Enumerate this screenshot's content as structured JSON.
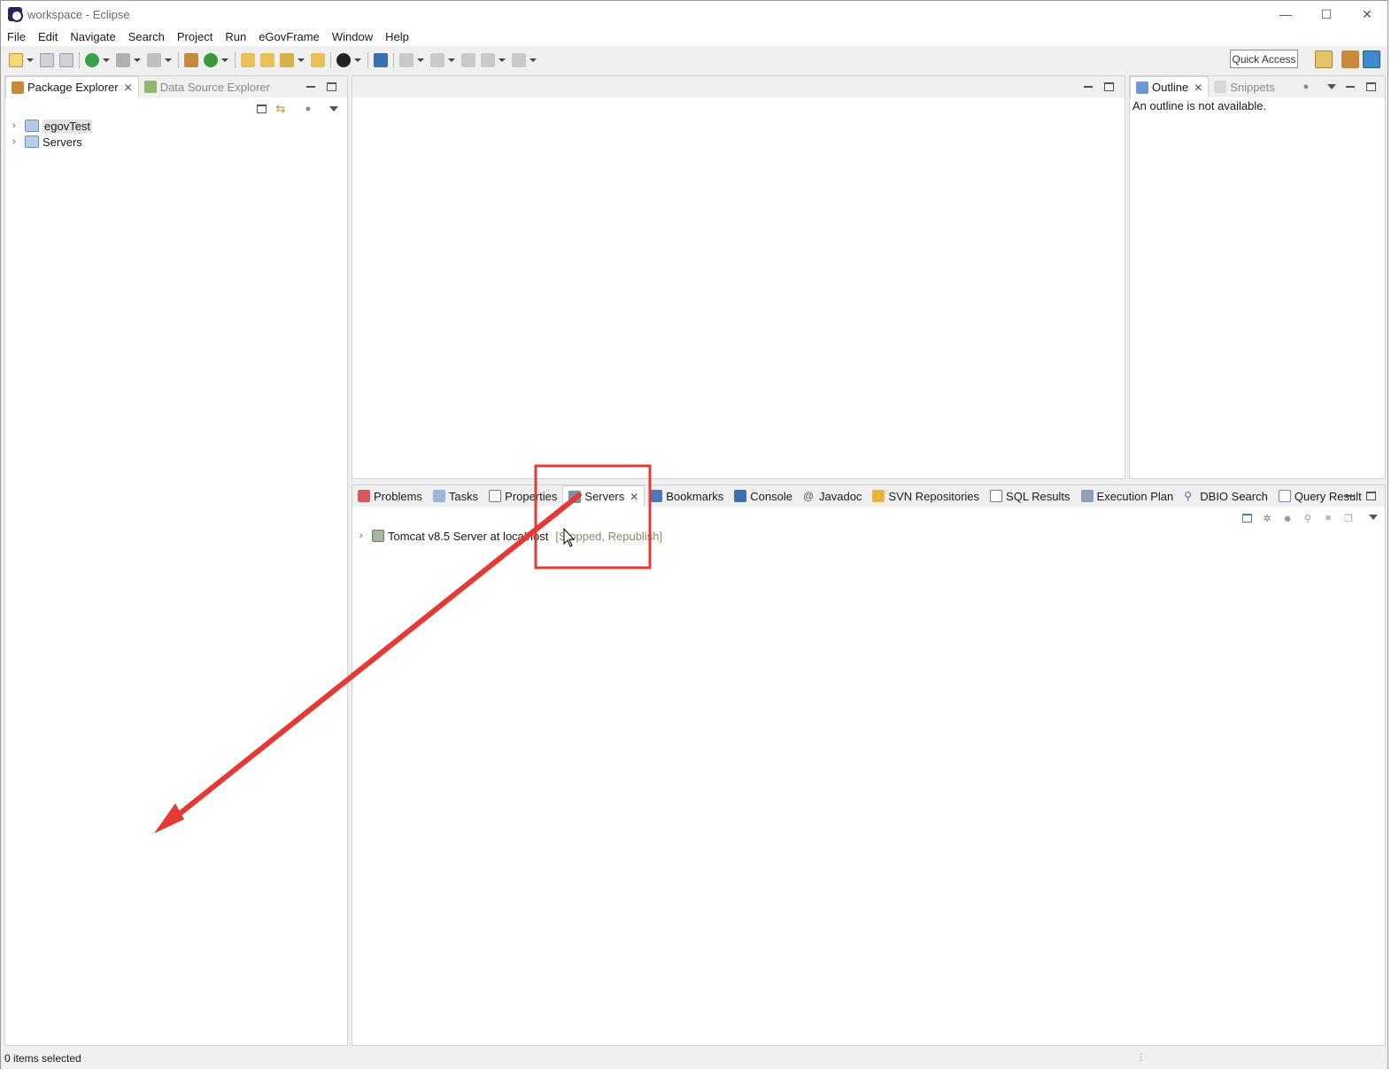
{
  "window": {
    "title": "workspace - Eclipse",
    "controls": {
      "minimize": "—",
      "maximize": "☐",
      "close": "✕"
    }
  },
  "menu": [
    "File",
    "Edit",
    "Navigate",
    "Search",
    "Project",
    "Run",
    "eGovFrame",
    "Window",
    "Help"
  ],
  "toolbar": {
    "quick_access": "Quick Access"
  },
  "left_panel": {
    "tabs": [
      {
        "label": "Package Explorer",
        "active": true
      },
      {
        "label": "Data Source Explorer",
        "active": false
      }
    ],
    "tree": [
      {
        "label": "egovTest",
        "icon": "project-icon"
      },
      {
        "label": "Servers",
        "icon": "folder-icon"
      }
    ]
  },
  "right_panel": {
    "tabs": [
      {
        "label": "Outline",
        "active": true
      },
      {
        "label": "Snippets",
        "active": false
      }
    ],
    "message": "An outline is not available."
  },
  "bottom_panel": {
    "tabs": [
      {
        "label": "Problems"
      },
      {
        "label": "Tasks"
      },
      {
        "label": "Properties"
      },
      {
        "label": "Servers",
        "active": true
      },
      {
        "label": "Bookmarks"
      },
      {
        "label": "Console"
      },
      {
        "label": "Javadoc"
      },
      {
        "label": "SVN Repositories"
      },
      {
        "label": "SQL Results"
      },
      {
        "label": "Execution Plan"
      },
      {
        "label": "DBIO Search"
      },
      {
        "label": "Query Result"
      }
    ],
    "server": {
      "name": "Tomcat v8.5 Server at localhost",
      "state": "[Stopped, Republish]"
    }
  },
  "status": {
    "text": "0 items selected"
  },
  "annotation": {
    "color": "#e53935"
  }
}
